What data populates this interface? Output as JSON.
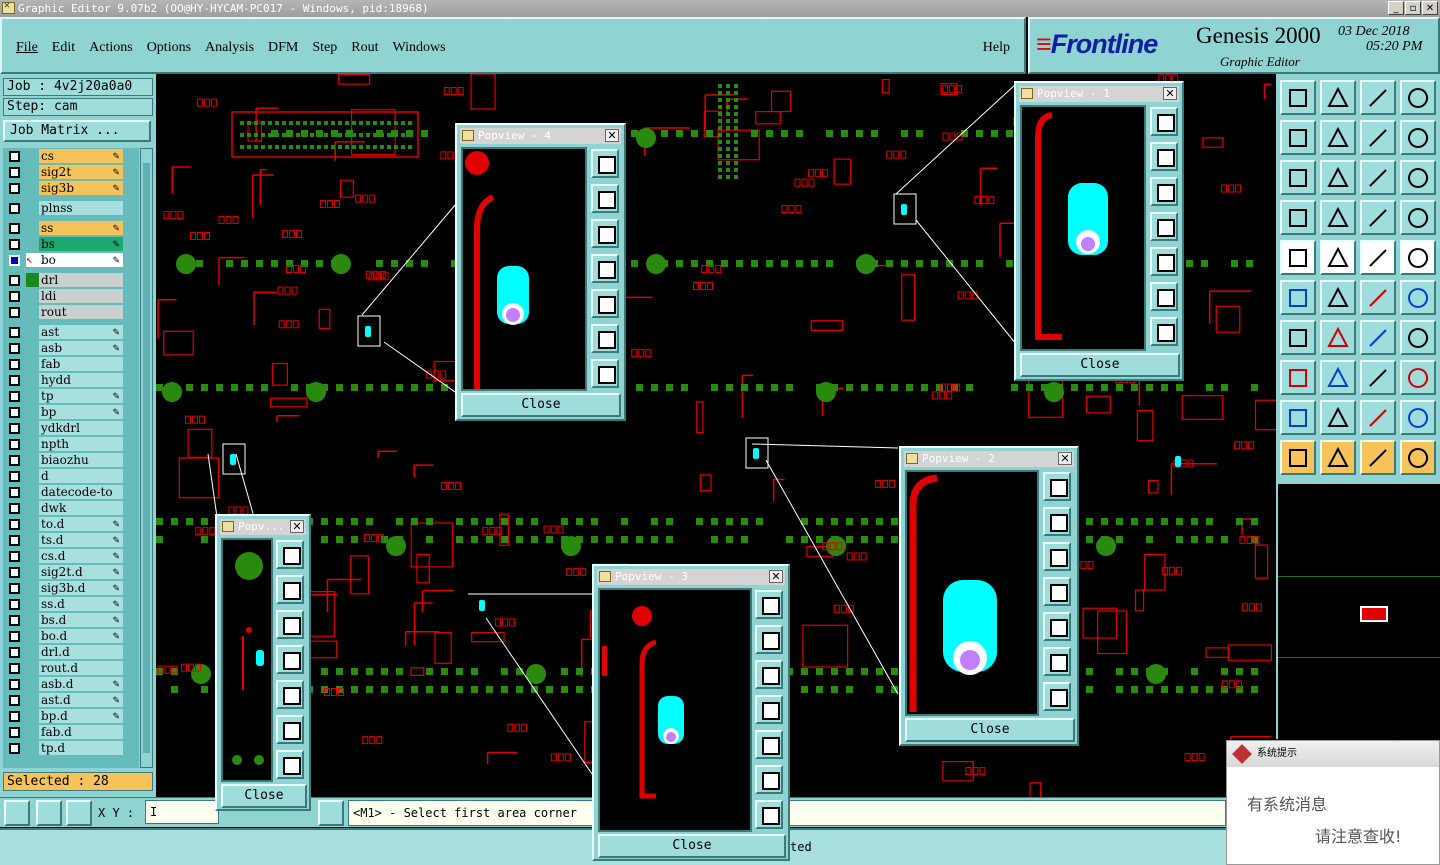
{
  "window": {
    "title": "Graphic Editor 9.07b2 (OO@HY-HYCAM-PC017 - Windows, pid:18968)"
  },
  "menu": [
    "File",
    "Edit",
    "Actions",
    "Options",
    "Analysis",
    "DFM",
    "Step",
    "Rout",
    "Windows"
  ],
  "help": "Help",
  "logo": {
    "brand": "Frontline",
    "product": "Genesis 2000",
    "subtitle": "Graphic Editor",
    "date": "03 Dec 2018",
    "time": "05:20 PM"
  },
  "job": "Job : 4v2j20a0a0",
  "step": "Step: cam",
  "job_matrix": "Job Matrix ...",
  "layers": [
    {
      "name": "cs",
      "color": "orange",
      "edit": true
    },
    {
      "name": "sig2t",
      "color": "orange",
      "edit": true
    },
    {
      "name": "sig3b",
      "color": "orange",
      "edit": true
    },
    {
      "name": "plnss",
      "color": "plain",
      "gap": true
    },
    {
      "name": "ss",
      "color": "orange",
      "edit": true,
      "gap": true
    },
    {
      "name": "bs",
      "color": "green",
      "edit": true
    },
    {
      "name": "bo",
      "color": "white",
      "edit": true,
      "work": true
    },
    {
      "name": "drl",
      "color": "gray",
      "gap": true
    },
    {
      "name": "ldi",
      "color": "gray"
    },
    {
      "name": "rout",
      "color": "gray"
    },
    {
      "name": "ast",
      "color": "plain",
      "edit": true,
      "gap": true
    },
    {
      "name": "asb",
      "color": "plain",
      "edit": true
    },
    {
      "name": "fab",
      "color": "plain"
    },
    {
      "name": "hydd",
      "color": "plain"
    },
    {
      "name": "tp",
      "color": "plain",
      "edit": true
    },
    {
      "name": "bp",
      "color": "plain",
      "edit": true
    },
    {
      "name": "ydkdrl",
      "color": "plain"
    },
    {
      "name": "npth",
      "color": "plain"
    },
    {
      "name": "biaozhu",
      "color": "plain"
    },
    {
      "name": "d",
      "color": "plain"
    },
    {
      "name": "datecode-to",
      "color": "plain"
    },
    {
      "name": "dwk",
      "color": "plain"
    },
    {
      "name": "to.d",
      "color": "plain",
      "edit": true
    },
    {
      "name": "ts.d",
      "color": "plain",
      "edit": true
    },
    {
      "name": "cs.d",
      "color": "plain",
      "edit": true
    },
    {
      "name": "sig2t.d",
      "color": "plain",
      "edit": true
    },
    {
      "name": "sig3b.d",
      "color": "plain",
      "edit": true
    },
    {
      "name": "ss.d",
      "color": "plain",
      "edit": true
    },
    {
      "name": "bs.d",
      "color": "plain",
      "edit": true
    },
    {
      "name": "bo.d",
      "color": "plain",
      "edit": true
    },
    {
      "name": "drl.d",
      "color": "plain"
    },
    {
      "name": "rout.d",
      "color": "plain"
    },
    {
      "name": "asb.d",
      "color": "plain",
      "edit": true
    },
    {
      "name": "ast.d",
      "color": "plain",
      "edit": true
    },
    {
      "name": "bp.d",
      "color": "plain",
      "edit": true
    },
    {
      "name": "fab.d",
      "color": "plain"
    },
    {
      "name": "tp.d",
      "color": "plain"
    }
  ],
  "selected": "Selected : 28",
  "xy_label": "X Y :",
  "xy_value": "I",
  "prompt": "<M1> - Select first area corner",
  "message": "ted",
  "popviews": [
    {
      "title": "Popview - 4",
      "close": "Close"
    },
    {
      "title": "Popview - 1",
      "close": "Close"
    },
    {
      "title": "Popv...",
      "close": "Close"
    },
    {
      "title": "Popview - 2",
      "close": "Close"
    },
    {
      "title": "Popview - 3",
      "close": "Close"
    }
  ],
  "system_tip": {
    "title": "系统提示",
    "line1": "有系统消息",
    "line2": "请注意查收!"
  },
  "colors": {
    "panel": "#8fd3d3",
    "copper": "#e00000",
    "pad": "#00ffff",
    "via": "#c080ff",
    "green_pad": "#2a8a10",
    "layer_active": "#f5c35a"
  }
}
